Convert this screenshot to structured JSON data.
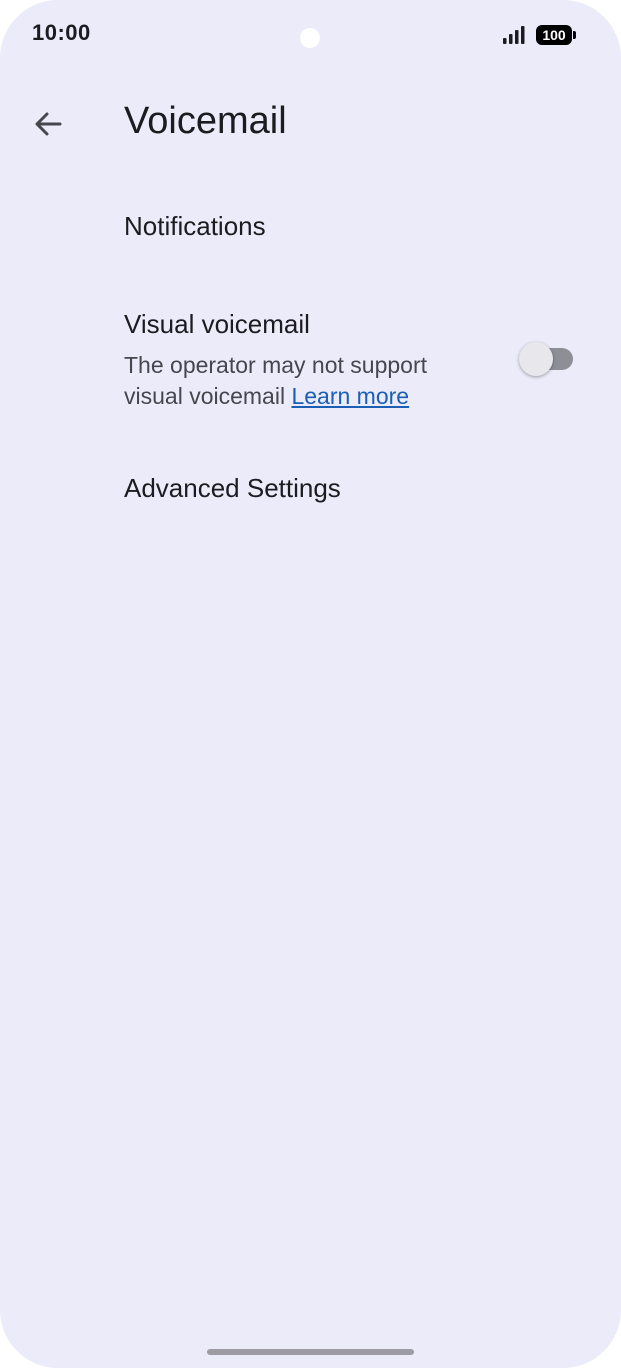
{
  "status_bar": {
    "time": "10:00",
    "battery": "100",
    "signal_icon": "cell-signal-icon"
  },
  "header": {
    "back_icon": "arrow-back-icon",
    "title": "Voicemail"
  },
  "settings": {
    "notifications": {
      "title": "Notifications"
    },
    "visual_voicemail": {
      "title": "Visual voicemail",
      "summary": "The operator may not support visual voicemail",
      "link": "Learn more",
      "enabled": false
    },
    "advanced": {
      "title": "Advanced Settings"
    }
  },
  "colors": {
    "background": "#ecebf9",
    "text_primary": "#1c1b20",
    "text_secondary": "#47464f",
    "link": "#1a5fb4",
    "toggle_track_off": "#8e8e96"
  }
}
